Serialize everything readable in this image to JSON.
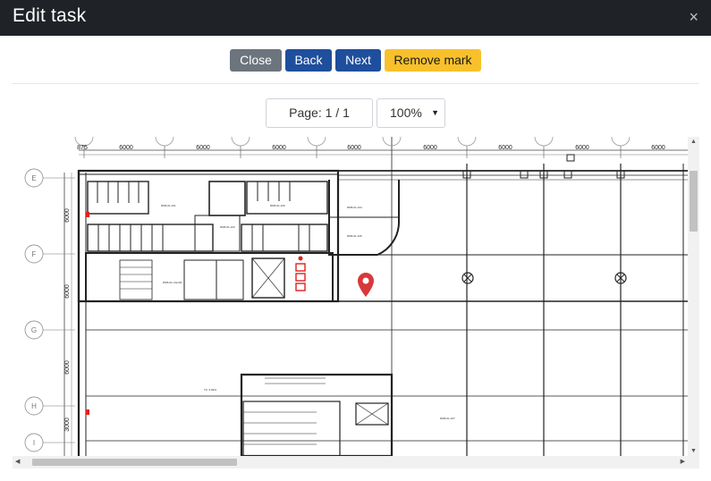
{
  "header": {
    "title": "Edit task",
    "close_symbol": "×"
  },
  "toolbar": {
    "close_label": "Close",
    "back_label": "Back",
    "next_label": "Next",
    "remove_mark_label": "Remove mark"
  },
  "pager": {
    "label": "Page: 1 / 1"
  },
  "zoom": {
    "value": "100%",
    "caret": "▼"
  },
  "plan": {
    "column_dims": [
      "875",
      "6000",
      "6000",
      "6000",
      "6000",
      "6000",
      "6000",
      "6000",
      "6000"
    ],
    "row_labels": [
      "E",
      "F",
      "G",
      "H",
      "I"
    ],
    "row_dims": [
      "6000",
      "6000",
      "6000",
      "3000"
    ],
    "marker_icon": "location-pin-icon",
    "marker_color": "#d9383a"
  },
  "colors": {
    "header_bg": "#1f2328",
    "primary": "#1f4e9c",
    "secondary": "#6c757d",
    "warning": "#f8c12c"
  }
}
